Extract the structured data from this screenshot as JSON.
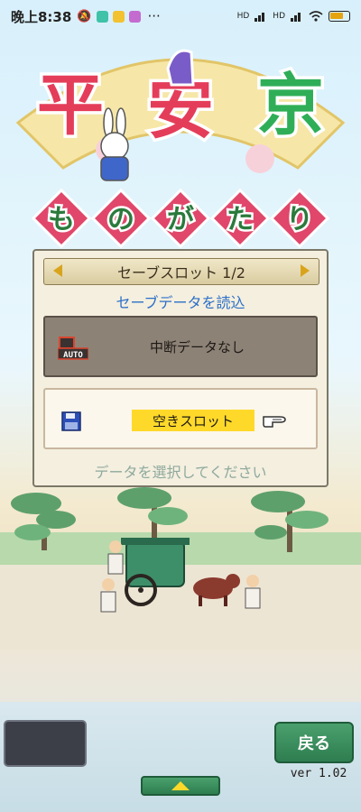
{
  "status_bar": {
    "time": "晚上8:38",
    "dots": "···",
    "signal_1": "HD",
    "signal_2": "HD"
  },
  "logo": {
    "title_chars": [
      "平",
      "安",
      "京"
    ],
    "subtitle_chars": [
      "も",
      "の",
      "が",
      "た",
      "り"
    ]
  },
  "panel": {
    "slot_header": "セーブスロット 1/2",
    "load_title": "セーブデータを読込",
    "auto_slot": {
      "icon_text": "AUTO",
      "label": "中断データなし"
    },
    "empty_slot": {
      "label": "空きスロット"
    },
    "hint": "データを選択してください"
  },
  "footer": {
    "back_label": "戻る",
    "version": "ver 1.02"
  },
  "colors": {
    "accent_green": "#2e7d50",
    "highlight_yellow": "#ffd92a",
    "load_title_blue": "#2c6fc7"
  }
}
